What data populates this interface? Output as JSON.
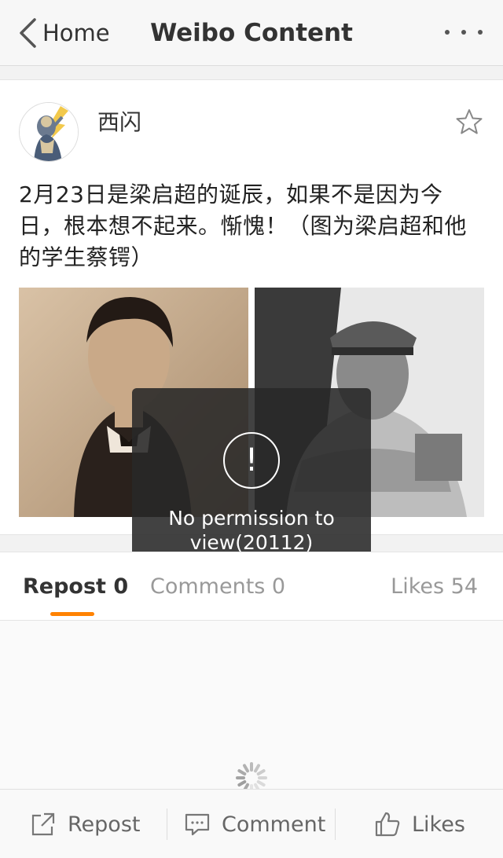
{
  "nav": {
    "back_label": "Home",
    "title": "Weibo Content",
    "more_icon": "more-dots-icon"
  },
  "post": {
    "username": "西闪",
    "text": "2月23日是梁启超的诞辰，如果不是因为今日，根本想不起来。惭愧！（图为梁启超和他的学生蔡锷）",
    "favorite_icon": "star-icon"
  },
  "toast": {
    "icon": "!",
    "message": "No permission to view(20112)"
  },
  "tabs": {
    "repost": "Repost 0",
    "comments": "Comments 0",
    "likes": "Likes 54",
    "active_color": "#ff8200"
  },
  "actions": {
    "repost": "Repost",
    "comment": "Comment",
    "likes": "Likes"
  }
}
